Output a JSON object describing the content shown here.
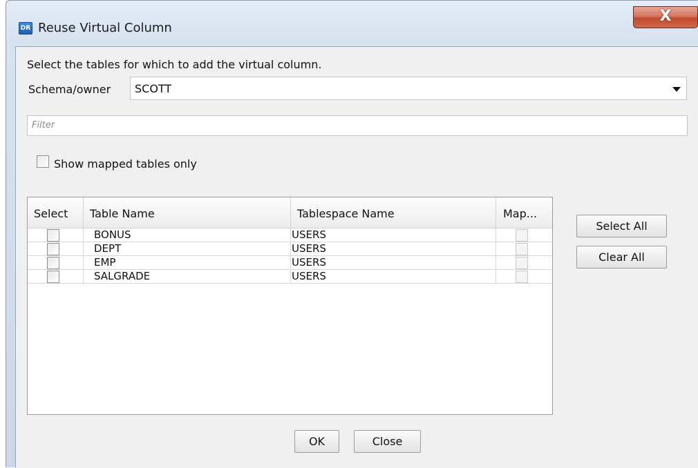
{
  "window": {
    "icon_text": "DR",
    "title": "Reuse Virtual Column",
    "close_glyph": "X"
  },
  "dialog": {
    "instruction": "Select the tables for which to add the virtual column.",
    "schema_label": "Schema/owner",
    "schema_value": "SCOTT",
    "filter_placeholder": "Filter",
    "show_mapped_label": "Show mapped tables only",
    "show_mapped_checked": false
  },
  "table": {
    "columns": [
      "Select",
      "Table Name",
      "Tablespace Name",
      "Map..."
    ],
    "rows": [
      {
        "select": false,
        "table_name": "BONUS",
        "tablespace": "USERS",
        "mapped": false
      },
      {
        "select": false,
        "table_name": "DEPT",
        "tablespace": "USERS",
        "mapped": false
      },
      {
        "select": false,
        "table_name": "EMP",
        "tablespace": "USERS",
        "mapped": false
      },
      {
        "select": false,
        "table_name": "SALGRADE",
        "tablespace": "USERS",
        "mapped": false
      }
    ]
  },
  "buttons": {
    "select_all": "Select All",
    "clear_all": "Clear All",
    "ok": "OK",
    "close": "Close"
  }
}
